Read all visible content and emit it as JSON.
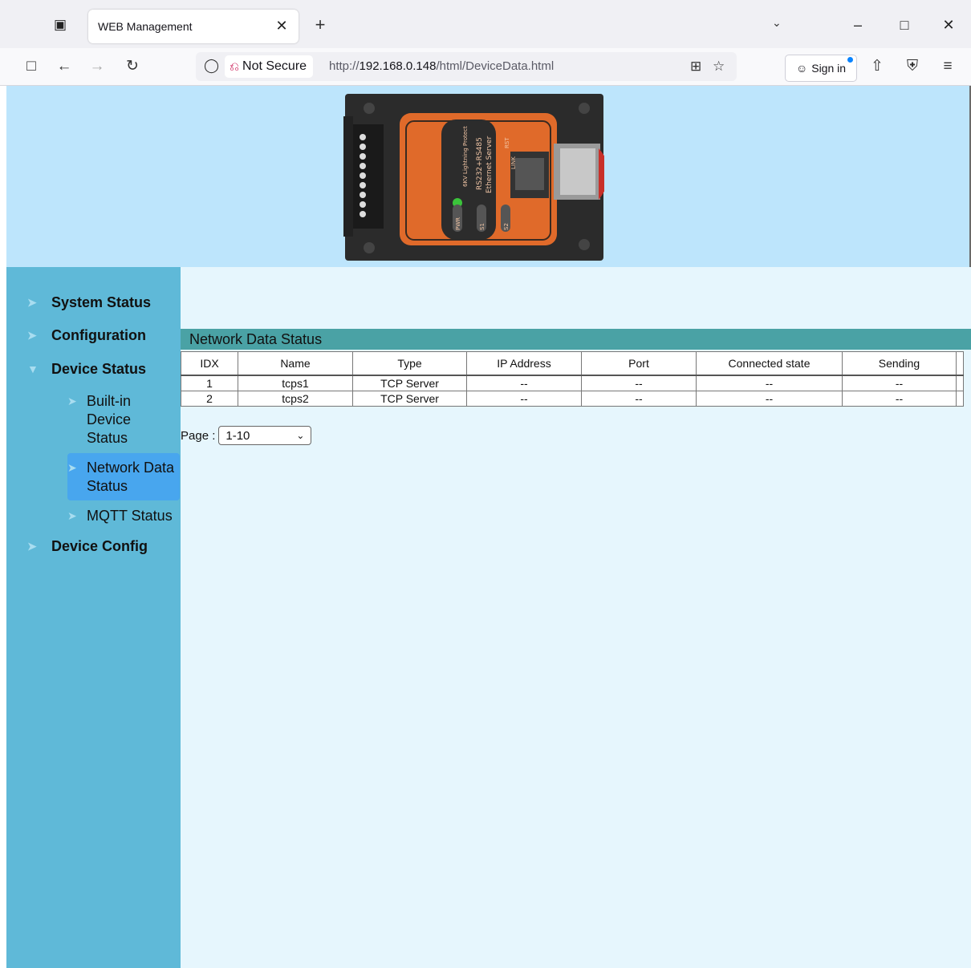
{
  "browser": {
    "tab_title": "WEB Management",
    "security_label": "Not Secure",
    "url_prefix": "http://",
    "url_host": "192.168.0.148",
    "url_path": "/html/DeviceData.html",
    "signin_label": "Sign in"
  },
  "device_image": {
    "labels": [
      "6KV Lightning Protect",
      "RS232+RS485",
      "Ethernet Server",
      "PWR",
      "S1",
      "S2",
      "RST",
      "LINK"
    ]
  },
  "sidebar": {
    "items": [
      {
        "label": "System Status"
      },
      {
        "label": "Configuration"
      },
      {
        "label": "Device Status"
      },
      {
        "label": "Device Config"
      }
    ],
    "sub_items": [
      {
        "label_lines": [
          "Built-in",
          "Device",
          "Status"
        ]
      },
      {
        "label_lines": [
          "Network Data",
          "Status"
        ],
        "active": true
      },
      {
        "label_lines": [
          "MQTT Status"
        ]
      }
    ]
  },
  "main": {
    "section_title": "Network Data Status",
    "table": {
      "columns": [
        "IDX",
        "Name",
        "Type",
        "IP Address",
        "Port",
        "Connected state",
        "Sending"
      ],
      "rows": [
        [
          "1",
          "tcps1",
          "TCP Server",
          "--",
          "--",
          "--",
          "--"
        ],
        [
          "2",
          "tcps2",
          "TCP Server",
          "--",
          "--",
          "--",
          "--"
        ]
      ]
    },
    "pager": {
      "label": "Page :",
      "selected": "1-10"
    }
  }
}
